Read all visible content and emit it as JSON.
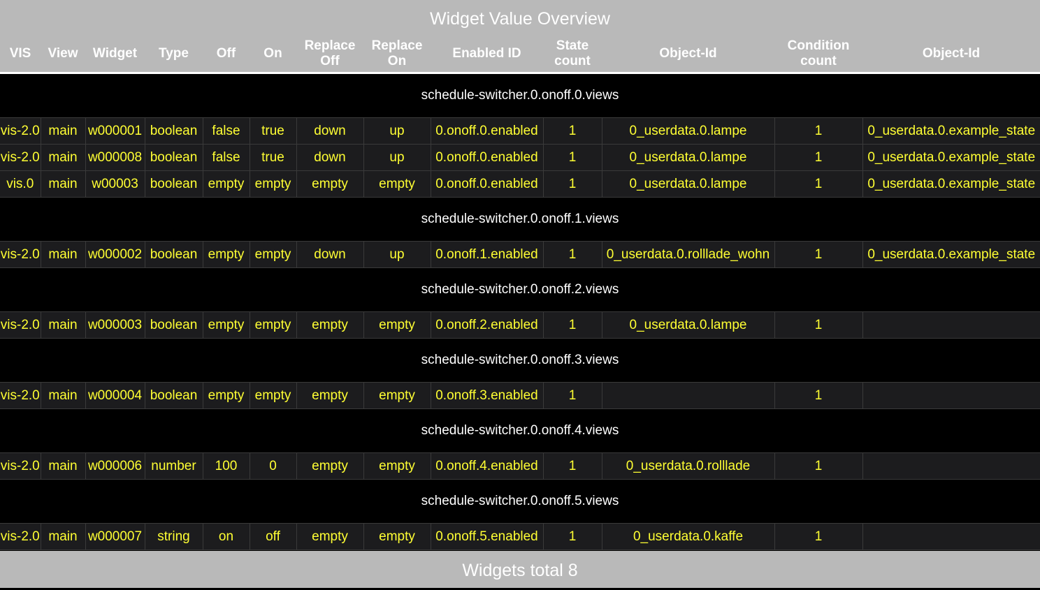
{
  "title": "Widget Value Overview",
  "headers": [
    "VIS",
    "View",
    "Widget",
    "Type",
    "Off",
    "On",
    "Replace Off",
    "Replace On",
    "Enabled ID",
    "State count",
    "Object-Id",
    "Condition count",
    "Object-Id"
  ],
  "groups": [
    {
      "label": "schedule-switcher.0.onoff.0.views",
      "rows": [
        [
          "vis-2.0",
          "main",
          "w000001",
          "boolean",
          "false",
          "true",
          "down",
          "up",
          "0.onoff.0.enabled",
          "1",
          "0_userdata.0.lampe",
          "1",
          "0_userdata.0.example_state"
        ],
        [
          "vis-2.0",
          "main",
          "w000008",
          "boolean",
          "false",
          "true",
          "down",
          "up",
          "0.onoff.0.enabled",
          "1",
          "0_userdata.0.lampe",
          "1",
          "0_userdata.0.example_state"
        ],
        [
          "vis.0",
          "main",
          "w00003",
          "boolean",
          "empty",
          "empty",
          "empty",
          "empty",
          "0.onoff.0.enabled",
          "1",
          "0_userdata.0.lampe",
          "1",
          "0_userdata.0.example_state"
        ]
      ]
    },
    {
      "label": "schedule-switcher.0.onoff.1.views",
      "rows": [
        [
          "vis-2.0",
          "main",
          "w000002",
          "boolean",
          "empty",
          "empty",
          "down",
          "up",
          "0.onoff.1.enabled",
          "1",
          "0_userdata.0.rolllade_wohn",
          "1",
          "0_userdata.0.example_state"
        ]
      ]
    },
    {
      "label": "schedule-switcher.0.onoff.2.views",
      "rows": [
        [
          "vis-2.0",
          "main",
          "w000003",
          "boolean",
          "empty",
          "empty",
          "empty",
          "empty",
          "0.onoff.2.enabled",
          "1",
          "0_userdata.0.lampe",
          "1",
          ""
        ]
      ]
    },
    {
      "label": "schedule-switcher.0.onoff.3.views",
      "rows": [
        [
          "vis-2.0",
          "main",
          "w000004",
          "boolean",
          "empty",
          "empty",
          "empty",
          "empty",
          "0.onoff.3.enabled",
          "1",
          "",
          "1",
          ""
        ]
      ]
    },
    {
      "label": "schedule-switcher.0.onoff.4.views",
      "rows": [
        [
          "vis-2.0",
          "main",
          "w000006",
          "number",
          "100",
          "0",
          "empty",
          "empty",
          "0.onoff.4.enabled",
          "1",
          "0_userdata.0.rolllade",
          "1",
          ""
        ]
      ]
    },
    {
      "label": "schedule-switcher.0.onoff.5.views",
      "rows": [
        [
          "vis-2.0",
          "main",
          "w000007",
          "string",
          "on",
          "off",
          "empty",
          "empty",
          "0.onoff.5.enabled",
          "1",
          "0_userdata.0.kaffe",
          "1",
          ""
        ]
      ]
    }
  ],
  "footer": "Widgets total 8",
  "colors": {
    "header_bg": "#b9b9b9",
    "row_bg": "#1c1c1e",
    "value_text": "#ffff33",
    "group_text": "#ffffff"
  }
}
